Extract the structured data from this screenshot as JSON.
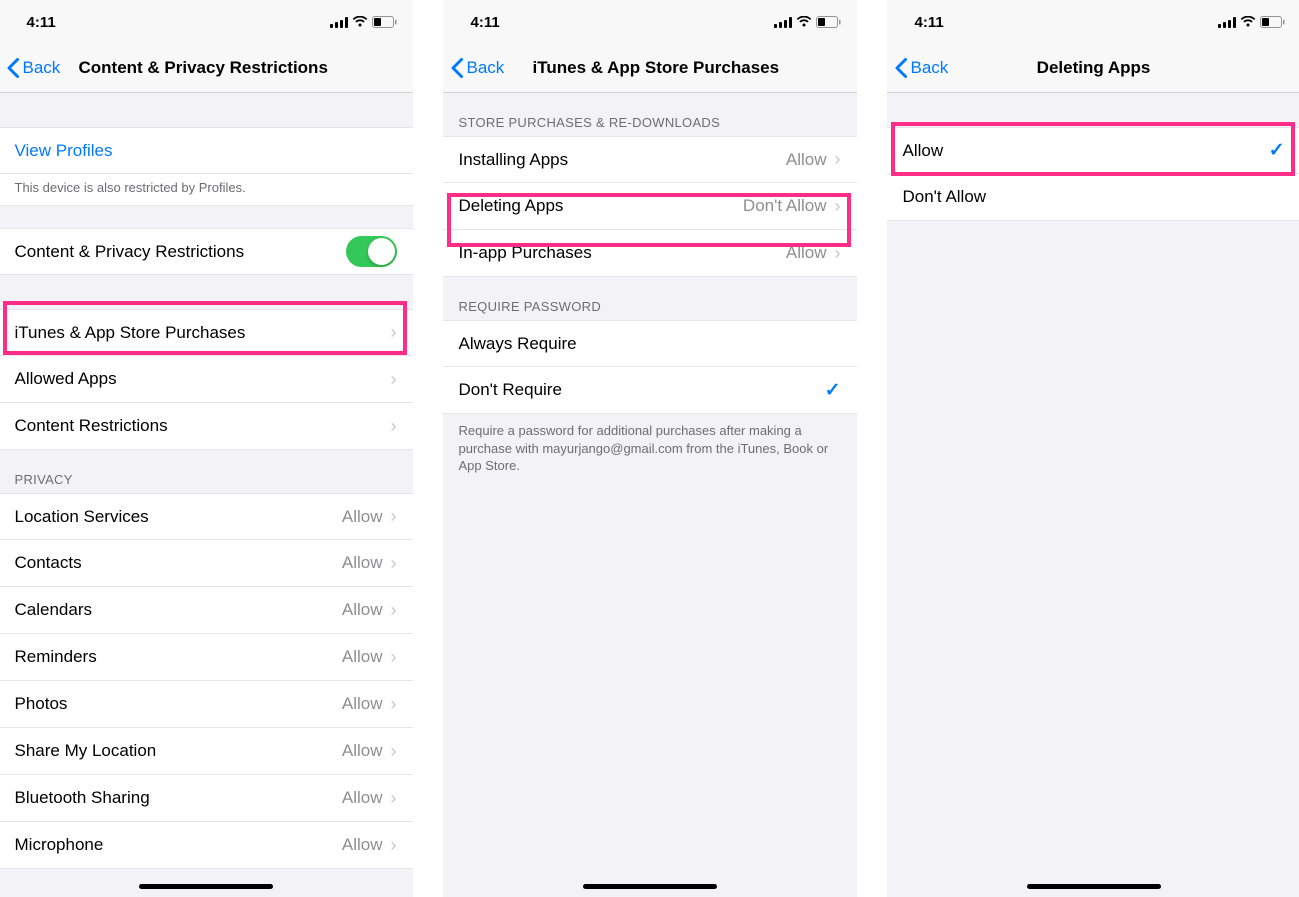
{
  "statusbar": {
    "time": "4:11"
  },
  "nav": {
    "back": "Back"
  },
  "screen1": {
    "title": "Content & Privacy Restrictions",
    "viewProfiles": "View Profiles",
    "profilesHint": "This device is also restricted by Profiles.",
    "toggleLabel": "Content & Privacy Restrictions",
    "rows": {
      "itunes": "iTunes & App Store Purchases",
      "allowedApps": "Allowed Apps",
      "contentRestrictions": "Content Restrictions"
    },
    "privacyHeader": "Privacy",
    "privacy": [
      {
        "label": "Location Services",
        "value": "Allow"
      },
      {
        "label": "Contacts",
        "value": "Allow"
      },
      {
        "label": "Calendars",
        "value": "Allow"
      },
      {
        "label": "Reminders",
        "value": "Allow"
      },
      {
        "label": "Photos",
        "value": "Allow"
      },
      {
        "label": "Share My Location",
        "value": "Allow"
      },
      {
        "label": "Bluetooth Sharing",
        "value": "Allow"
      },
      {
        "label": "Microphone",
        "value": "Allow"
      }
    ]
  },
  "screen2": {
    "title": "iTunes & App Store Purchases",
    "storeHeader": "Store Purchases & Re-downloads",
    "store": [
      {
        "label": "Installing Apps",
        "value": "Allow"
      },
      {
        "label": "Deleting Apps",
        "value": "Don't Allow"
      },
      {
        "label": "In-app Purchases",
        "value": "Allow"
      }
    ],
    "requireHeader": "Require Password",
    "require": [
      {
        "label": "Always Require",
        "checked": false
      },
      {
        "label": "Don't Require",
        "checked": true
      }
    ],
    "footer": "Require a password for additional purchases after making a purchase with mayurjango@gmail.com from the iTunes, Book or App Store."
  },
  "screen3": {
    "title": "Deleting Apps",
    "options": [
      {
        "label": "Allow",
        "checked": true
      },
      {
        "label": "Don't Allow",
        "checked": false
      }
    ]
  }
}
